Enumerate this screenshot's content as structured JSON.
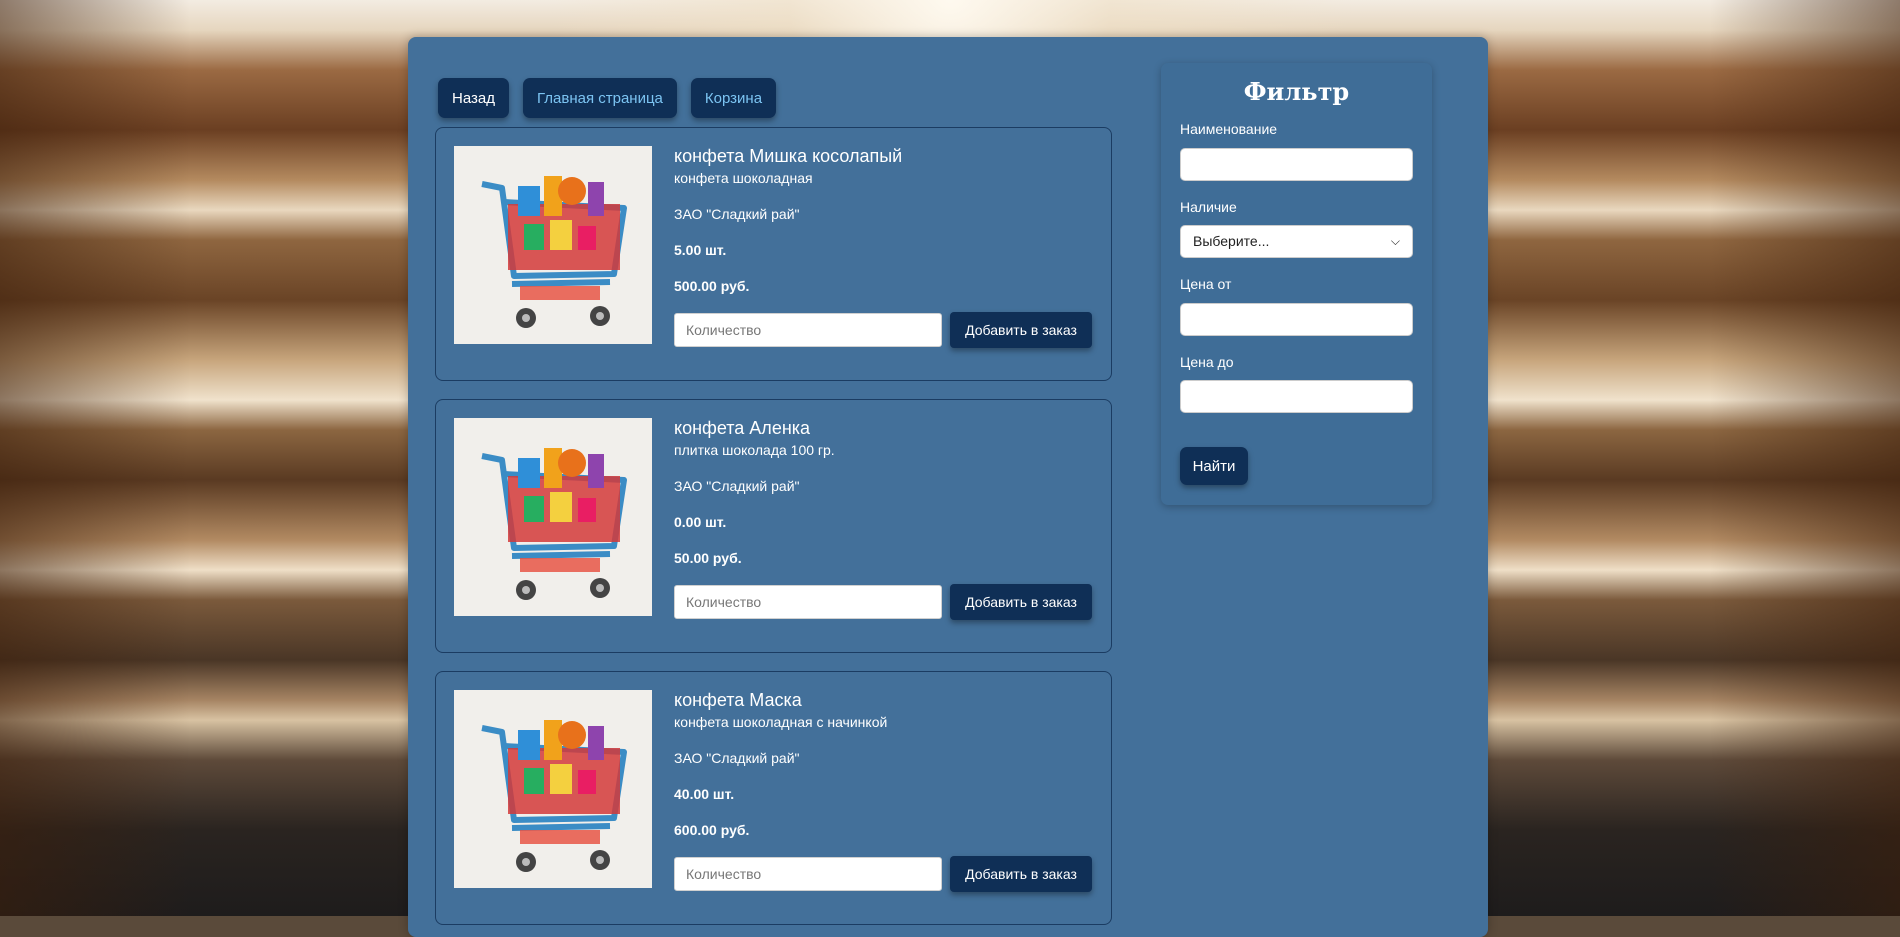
{
  "nav": {
    "back_label": "Назад",
    "home_label": "Главная страница",
    "cart_label": "Корзина"
  },
  "products": [
    {
      "name": "конфета Мишка косолапый",
      "description": "конфета шоколадная",
      "manufacturer": "ЗАО \"Сладкий рай\"",
      "quantity": "5.00 шт.",
      "price": "500.00 руб.",
      "qty_placeholder": "Количество",
      "add_label": "Добавить в заказ"
    },
    {
      "name": "конфета Аленка",
      "description": "плитка шоколада 100 гр.",
      "manufacturer": "ЗАО \"Сладкий рай\"",
      "quantity": "0.00 шт.",
      "price": "50.00 руб.",
      "qty_placeholder": "Количество",
      "add_label": "Добавить в заказ"
    },
    {
      "name": "конфета Маска",
      "description": "конфета шоколадная с начинкой",
      "manufacturer": "ЗАО \"Сладкий рай\"",
      "quantity": "40.00 шт.",
      "price": "600.00 руб.",
      "qty_placeholder": "Количество",
      "add_label": "Добавить в заказ"
    }
  ],
  "filter": {
    "title": "Фильтр",
    "name_label": "Наименование",
    "availability_label": "Наличие",
    "availability_selected": "Выберите...",
    "price_from_label": "Цена от",
    "price_to_label": "Цена до",
    "find_label": "Найти"
  },
  "colors": {
    "panel": "#43709a",
    "button": "#0f2f56",
    "link": "#7cc4f2"
  }
}
